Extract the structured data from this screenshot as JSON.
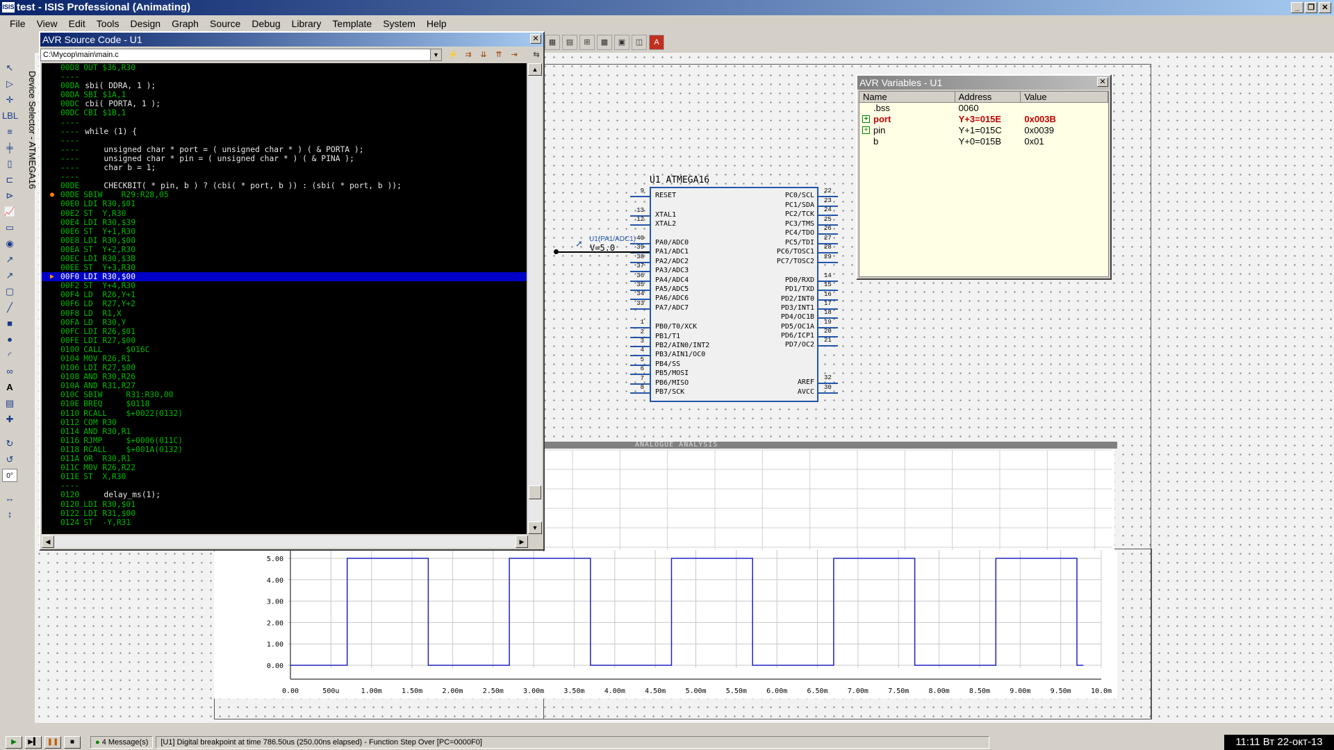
{
  "window": {
    "title": "test - ISIS Professional (Animating)",
    "icon": "ISIS"
  },
  "menu": [
    "File",
    "View",
    "Edit",
    "Tools",
    "Design",
    "Graph",
    "Source",
    "Debug",
    "Library",
    "Template",
    "System",
    "Help"
  ],
  "device_selector": "Device Selector - ATMEGA16",
  "source_window": {
    "title": "AVR Source Code - U1",
    "path": "C:\\Mycop\\main\\main.c",
    "lines": [
      {
        "addr": "00D8",
        "code": "OUT $36,R30",
        "kind": "asm"
      },
      {
        "addr": "----",
        "code": "",
        "kind": "sep"
      },
      {
        "addr": "00DA",
        "code": "sbi( DDRA, 1 );",
        "kind": "c"
      },
      {
        "addr": "00DA",
        "code": "SBI $1A,1",
        "kind": "asm"
      },
      {
        "addr": "00DC",
        "code": "cbi( PORTA, 1 );",
        "kind": "c"
      },
      {
        "addr": "00DC",
        "code": "CBI $1B,1",
        "kind": "asm"
      },
      {
        "addr": "----",
        "code": "",
        "kind": "sep"
      },
      {
        "addr": "----",
        "code": "while (1) {",
        "kind": "c"
      },
      {
        "addr": "----",
        "code": "",
        "kind": "sep"
      },
      {
        "addr": "----",
        "code": "    unsigned char * port = ( unsigned char * ) ( & PORTA );",
        "kind": "c"
      },
      {
        "addr": "----",
        "code": "    unsigned char * pin = ( unsigned char * ) ( & PINA );",
        "kind": "c"
      },
      {
        "addr": "----",
        "code": "    char b = 1;",
        "kind": "c"
      },
      {
        "addr": "----",
        "code": "",
        "kind": "sep"
      },
      {
        "addr": "00DE",
        "code": "    CHECKBIT( * pin, b ) ? (cbi( * port, b )) : (sbi( * port, b ));",
        "kind": "c"
      },
      {
        "addr": "00DE",
        "code": "SBIW    R29:R28,05",
        "kind": "asm",
        "mark": "dot"
      },
      {
        "addr": "00E0",
        "code": "LDI R30,$01",
        "kind": "asm"
      },
      {
        "addr": "00E2",
        "code": "ST  Y,R30",
        "kind": "asm"
      },
      {
        "addr": "00E4",
        "code": "LDI R30,$39",
        "kind": "asm"
      },
      {
        "addr": "00E6",
        "code": "ST  Y+1,R30",
        "kind": "asm"
      },
      {
        "addr": "00E8",
        "code": "LDI R30,$00",
        "kind": "asm"
      },
      {
        "addr": "00EA",
        "code": "ST  Y+2,R30",
        "kind": "asm"
      },
      {
        "addr": "00EC",
        "code": "LDI R30,$3B",
        "kind": "asm"
      },
      {
        "addr": "00EE",
        "code": "ST  Y+3,R30",
        "kind": "asm"
      },
      {
        "addr": "00F0",
        "code": "LDI R30,$00",
        "kind": "asm",
        "mark": "arrow",
        "highlight": true
      },
      {
        "addr": "00F2",
        "code": "ST  Y+4,R30",
        "kind": "asm"
      },
      {
        "addr": "00F4",
        "code": "LD  R26,Y+1",
        "kind": "asm"
      },
      {
        "addr": "00F6",
        "code": "LD  R27,Y+2",
        "kind": "asm"
      },
      {
        "addr": "00F8",
        "code": "LD  R1,X",
        "kind": "asm"
      },
      {
        "addr": "00FA",
        "code": "LD  R30,Y",
        "kind": "asm"
      },
      {
        "addr": "00FC",
        "code": "LDI R26,$01",
        "kind": "asm"
      },
      {
        "addr": "00FE",
        "code": "LDI R27,$00",
        "kind": "asm"
      },
      {
        "addr": "0100",
        "code": "CALL     $016C",
        "kind": "asm"
      },
      {
        "addr": "0104",
        "code": "MOV R26,R1",
        "kind": "asm"
      },
      {
        "addr": "0106",
        "code": "LDI R27,$00",
        "kind": "asm"
      },
      {
        "addr": "0108",
        "code": "AND R30,R26",
        "kind": "asm"
      },
      {
        "addr": "010A",
        "code": "AND R31,R27",
        "kind": "asm"
      },
      {
        "addr": "010C",
        "code": "SBIW     R31:R30,00",
        "kind": "asm"
      },
      {
        "addr": "010E",
        "code": "BREQ     $0118",
        "kind": "asm"
      },
      {
        "addr": "0110",
        "code": "RCALL    $+0022(0132)",
        "kind": "asm"
      },
      {
        "addr": "0112",
        "code": "COM R30",
        "kind": "asm"
      },
      {
        "addr": "0114",
        "code": "AND R30,R1",
        "kind": "asm"
      },
      {
        "addr": "0116",
        "code": "RJMP     $+0006(011C)",
        "kind": "asm"
      },
      {
        "addr": "0118",
        "code": "RCALL    $+001A(0132)",
        "kind": "asm"
      },
      {
        "addr": "011A",
        "code": "OR  R30,R1",
        "kind": "asm"
      },
      {
        "addr": "011C",
        "code": "MOV R26,R22",
        "kind": "asm"
      },
      {
        "addr": "011E",
        "code": "ST  X,R30",
        "kind": "asm"
      },
      {
        "addr": "----",
        "code": "",
        "kind": "sep"
      },
      {
        "addr": "0120",
        "code": "    delay_ms(1);",
        "kind": "c"
      },
      {
        "addr": "0120",
        "code": "LDI R30,$01",
        "kind": "asm"
      },
      {
        "addr": "0122",
        "code": "LDI R31,$00",
        "kind": "asm"
      },
      {
        "addr": "0124",
        "code": "ST  -Y,R31",
        "kind": "asm"
      }
    ]
  },
  "variables_window": {
    "title": "AVR Variables - U1",
    "headers": [
      "Name",
      "Address",
      "Value"
    ],
    "rows": [
      {
        "name": ".bss",
        "address": "0060",
        "value": "",
        "expand": false,
        "changed": false
      },
      {
        "name": "port",
        "address": "Y+3=015E",
        "value": "0x003B",
        "expand": true,
        "changed": true
      },
      {
        "name": "pin",
        "address": "Y+1=015C",
        "value": "0x0039",
        "expand": true,
        "changed": false
      },
      {
        "name": "b",
        "address": "Y+0=015B",
        "value": "0x01",
        "expand": false,
        "changed": false
      }
    ]
  },
  "chip": {
    "label": "U1 ATMEGA16",
    "left_pins": [
      {
        "num": "9",
        "name": "RESET"
      },
      {
        "num": "13",
        "name": "XTAL1"
      },
      {
        "num": "12",
        "name": "XTAL2"
      },
      {
        "num": "40",
        "name": "PA0/ADC0"
      },
      {
        "num": "39",
        "name": "PA1/ADC1"
      },
      {
        "num": "38",
        "name": "PA2/ADC2"
      },
      {
        "num": "37",
        "name": "PA3/ADC3"
      },
      {
        "num": "36",
        "name": "PA4/ADC4"
      },
      {
        "num": "35",
        "name": "PA5/ADC5"
      },
      {
        "num": "34",
        "name": "PA6/ADC6"
      },
      {
        "num": "33",
        "name": "PA7/ADC7"
      },
      {
        "num": "1",
        "name": "PB0/T0/XCK"
      },
      {
        "num": "2",
        "name": "PB1/T1"
      },
      {
        "num": "3",
        "name": "PB2/AIN0/INT2"
      },
      {
        "num": "4",
        "name": "PB3/AIN1/OC0"
      },
      {
        "num": "5",
        "name": "PB4/SS"
      },
      {
        "num": "6",
        "name": "PB5/MOSI"
      },
      {
        "num": "7",
        "name": "PB6/MISO"
      },
      {
        "num": "8",
        "name": "PB7/SCK"
      }
    ],
    "right_pins": [
      {
        "num": "22",
        "name": "PC0/SCL"
      },
      {
        "num": "23",
        "name": "PC1/SDA"
      },
      {
        "num": "24",
        "name": "PC2/TCK"
      },
      {
        "num": "25",
        "name": "PC3/TMS"
      },
      {
        "num": "26",
        "name": "PC4/TDO"
      },
      {
        "num": "27",
        "name": "PC5/TDI"
      },
      {
        "num": "28",
        "name": "PC6/TOSC1"
      },
      {
        "num": "29",
        "name": "PC7/TOSC2"
      },
      {
        "num": "14",
        "name": "PD0/RXD"
      },
      {
        "num": "15",
        "name": "PD1/TXD"
      },
      {
        "num": "16",
        "name": "PD2/INT0"
      },
      {
        "num": "17",
        "name": "PD3/INT1"
      },
      {
        "num": "18",
        "name": "PD4/OC1B"
      },
      {
        "num": "19",
        "name": "PD5/OC1A"
      },
      {
        "num": "20",
        "name": "PD6/ICP1"
      },
      {
        "num": "21",
        "name": "PD7/OC2"
      },
      {
        "num": "32",
        "name": "AREF"
      },
      {
        "num": "30",
        "name": "AVCC"
      }
    ],
    "probe_label": "U1(PA1/ADC1)",
    "probe_value": "V=5.0"
  },
  "chart_data": {
    "type": "line",
    "title": "ANALOGUE ANALYSIS",
    "xlabel": "",
    "ylabel": "",
    "xlim": [
      0,
      10
    ],
    "ylim": [
      0,
      5
    ],
    "x_unit": "m",
    "x_ticks": [
      "0.00",
      "500u",
      "1.00m",
      "1.50m",
      "2.00m",
      "2.50m",
      "3.00m",
      "3.50m",
      "4.00m",
      "4.50m",
      "5.00m",
      "5.50m",
      "6.00m",
      "6.50m",
      "7.00m",
      "7.50m",
      "8.00m",
      "8.50m",
      "9.00m",
      "9.50m",
      "10.0m"
    ],
    "y_ticks": [
      "0.00",
      "1.00",
      "2.00",
      "3.00",
      "4.00",
      "5.00"
    ],
    "series": [
      {
        "color": "#2020c0",
        "x": [
          0,
          0.7,
          0.7,
          1.7,
          1.7,
          2.7,
          2.7,
          3.7,
          3.7,
          4.7,
          4.7,
          5.7,
          5.7,
          6.7,
          6.7,
          7.7,
          7.7,
          8.7,
          8.7,
          9.7,
          9.7,
          9.78
        ],
        "y": [
          0,
          0,
          5,
          5,
          0,
          0,
          5,
          5,
          0,
          0,
          5,
          5,
          0,
          0,
          5,
          5,
          0,
          0,
          5,
          5,
          0,
          0
        ]
      }
    ],
    "grid": true
  },
  "status": {
    "messages": "4 Message(s)",
    "text": "[U1] Digital breakpoint at time 786.50us (250.00ns elapsed) - Function Step Over [PC=0000F0]",
    "clock": "11:11  Вт 22-окт-13"
  },
  "icons": {
    "play": "play-icon",
    "step": "step-icon",
    "pause": "pause-icon",
    "stop": "stop-icon"
  }
}
